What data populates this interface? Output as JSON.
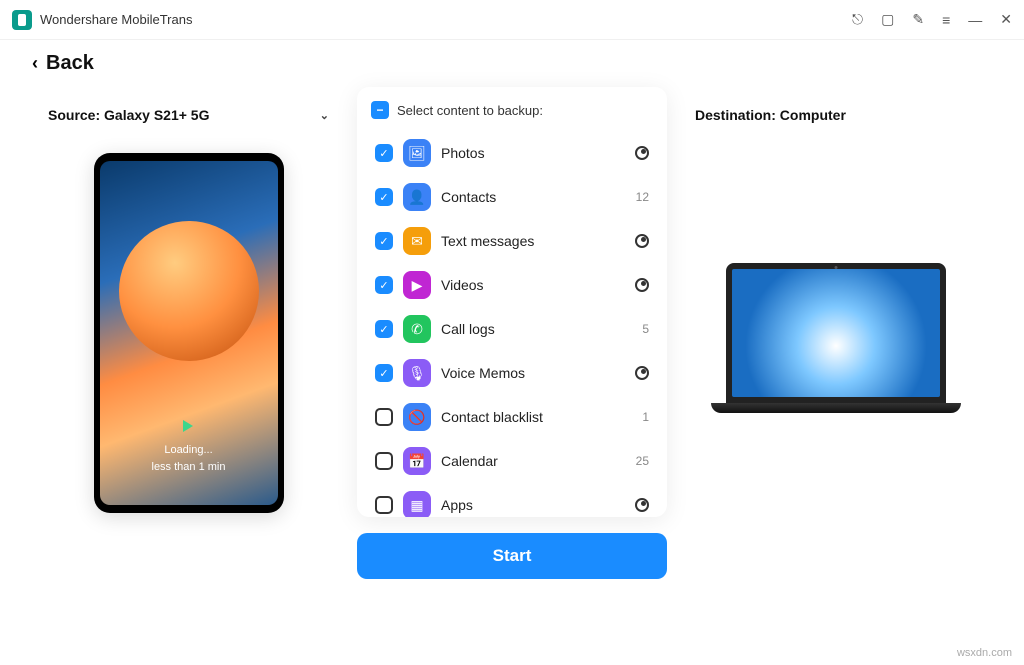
{
  "app": {
    "title": "Wondershare MobileTrans"
  },
  "back_label": "Back",
  "source": {
    "label": "Source: Galaxy S21+ 5G"
  },
  "destination": {
    "label": "Destination: Computer"
  },
  "phone": {
    "loading": "Loading...",
    "eta": "less than 1 min"
  },
  "list": {
    "header": "Select content to backup:",
    "items": [
      {
        "label": "Photos",
        "count": null,
        "loading": true,
        "checked": true,
        "icon_bg": "#3b82f6",
        "glyph": "🖼"
      },
      {
        "label": "Contacts",
        "count": "12",
        "loading": false,
        "checked": true,
        "icon_bg": "#3b82f6",
        "glyph": "👤"
      },
      {
        "label": "Text messages",
        "count": null,
        "loading": true,
        "checked": true,
        "icon_bg": "#f59e0b",
        "glyph": "✉"
      },
      {
        "label": "Videos",
        "count": null,
        "loading": true,
        "checked": true,
        "icon_bg": "#c026d3",
        "glyph": "▶"
      },
      {
        "label": "Call logs",
        "count": "5",
        "loading": false,
        "checked": true,
        "icon_bg": "#22c55e",
        "glyph": "✆"
      },
      {
        "label": "Voice Memos",
        "count": null,
        "loading": true,
        "checked": true,
        "icon_bg": "#8b5cf6",
        "glyph": "🎙"
      },
      {
        "label": "Contact blacklist",
        "count": "1",
        "loading": false,
        "checked": false,
        "icon_bg": "#3b82f6",
        "glyph": "🚫"
      },
      {
        "label": "Calendar",
        "count": "25",
        "loading": false,
        "checked": false,
        "icon_bg": "#8b5cf6",
        "glyph": "📅"
      },
      {
        "label": "Apps",
        "count": null,
        "loading": true,
        "checked": false,
        "icon_bg": "#8b5cf6",
        "glyph": "▦"
      }
    ]
  },
  "start_label": "Start",
  "watermark": "wsxdn.com"
}
